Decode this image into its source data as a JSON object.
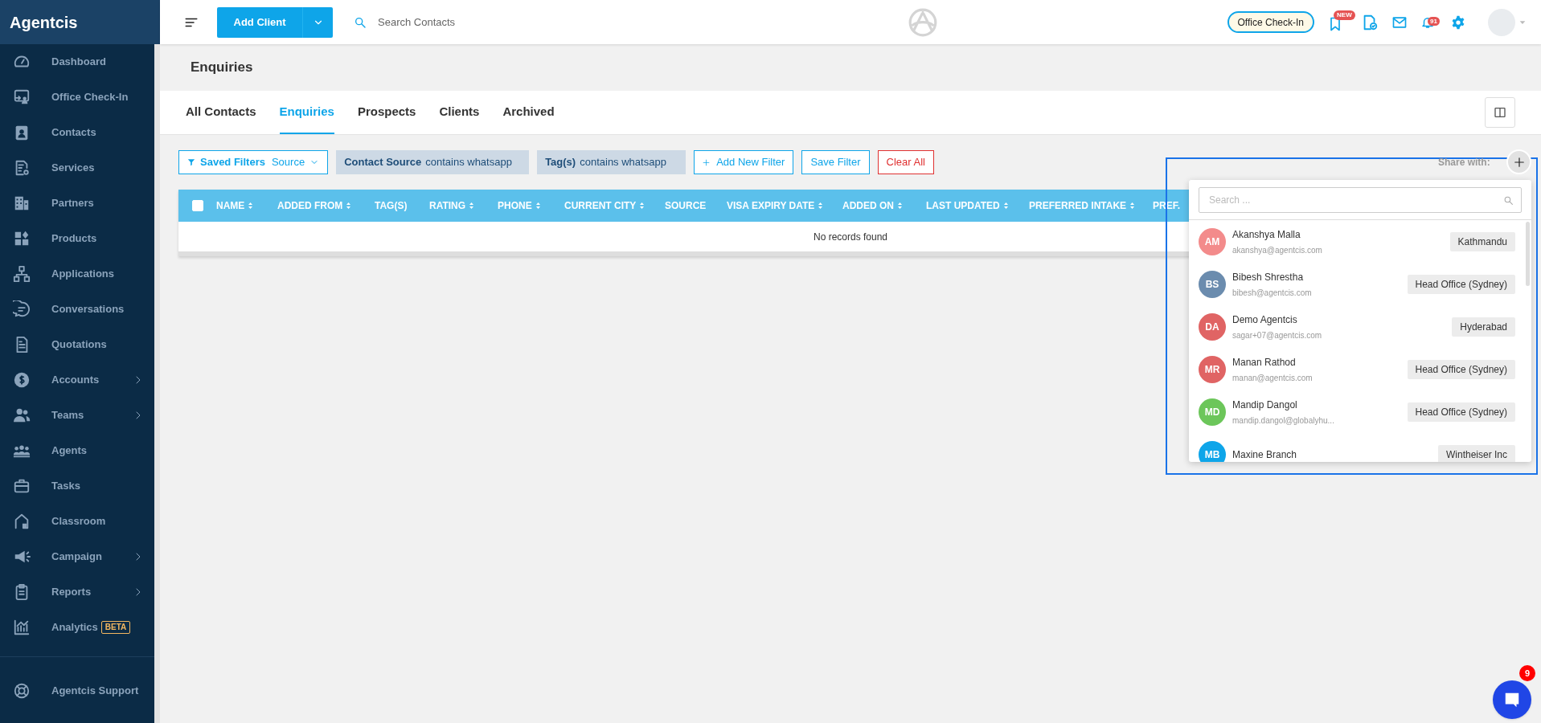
{
  "sidebar": {
    "brand": "Agentcis",
    "items": [
      {
        "label": "Dashboard",
        "expandable": false
      },
      {
        "label": "Office Check-In",
        "expandable": false
      },
      {
        "label": "Contacts",
        "expandable": false
      },
      {
        "label": "Services",
        "expandable": false
      },
      {
        "label": "Partners",
        "expandable": false
      },
      {
        "label": "Products",
        "expandable": false
      },
      {
        "label": "Applications",
        "expandable": false
      },
      {
        "label": "Conversations",
        "expandable": false
      },
      {
        "label": "Quotations",
        "expandable": false
      },
      {
        "label": "Accounts",
        "expandable": true
      },
      {
        "label": "Teams",
        "expandable": true
      },
      {
        "label": "Agents",
        "expandable": false
      },
      {
        "label": "Tasks",
        "expandable": false
      },
      {
        "label": "Classroom",
        "expandable": false
      },
      {
        "label": "Campaign",
        "expandable": true
      },
      {
        "label": "Reports",
        "expandable": true
      },
      {
        "label": "Analytics",
        "expandable": false,
        "badge": "BETA"
      }
    ],
    "footer_items": [
      {
        "label": "Agentcis Support"
      }
    ]
  },
  "top_bar": {
    "add_button": "Add Client",
    "search": {
      "placeholder": "Search Contacts"
    },
    "check_in_button": "Office Check-In",
    "updates_badge": "NEW",
    "notifications_badge": "91"
  },
  "page": {
    "title": "Enquiries"
  },
  "tabs": [
    {
      "label": "All Contacts",
      "selected": false
    },
    {
      "label": "Enquiries",
      "selected": true
    },
    {
      "label": "Prospects",
      "selected": false
    },
    {
      "label": "Clients",
      "selected": false
    },
    {
      "label": "Archived",
      "selected": false
    }
  ],
  "filters": {
    "saved_filters": {
      "label": "Saved Filters",
      "value": "Source"
    },
    "conditions": [
      {
        "field": "Contact Source",
        "condition": "contains whatsapp"
      },
      {
        "field": "Tag(s)",
        "condition": "contains whatsapp"
      }
    ],
    "add_button": "Add New Filter",
    "save_button": "Save Filter",
    "clear_button": "Clear All"
  },
  "table": {
    "select_all": {
      "checked": false
    },
    "columns": [
      {
        "label": "NAME",
        "sortable": true
      },
      {
        "label": "ADDED FROM",
        "sortable": true
      },
      {
        "label": "TAG(S)",
        "sortable": false
      },
      {
        "label": "RATING",
        "sortable": true
      },
      {
        "label": "PHONE",
        "sortable": true
      },
      {
        "label": "CURRENT CITY",
        "sortable": true
      },
      {
        "label": "SOURCE",
        "sortable": false
      },
      {
        "label": "VISA EXPIRY DATE",
        "sortable": true
      },
      {
        "label": "ADDED ON",
        "sortable": true
      },
      {
        "label": "LAST UPDATED",
        "sortable": true
      },
      {
        "label": "PREFERRED INTAKE",
        "sortable": true
      },
      {
        "label": "PREF.",
        "sortable": false
      }
    ],
    "empty_message": "No records found"
  },
  "share_panel": {
    "label": "Share with:",
    "search": {
      "placeholder": "Search ..."
    },
    "users": [
      {
        "initials": "AM",
        "name": "Akanshya Malla",
        "email": "akanshya@agentcis.com",
        "office": "Kathmandu",
        "color": "#f38b8b"
      },
      {
        "initials": "BS",
        "name": "Bibesh Shrestha",
        "email": "bibesh@agentcis.com",
        "office": "Head Office (Sydney)",
        "color": "#6b8cae"
      },
      {
        "initials": "DA",
        "name": "Demo Agentcis",
        "email": "sagar+07@agentcis.com",
        "office": "Hyderabad",
        "color": "#e06464"
      },
      {
        "initials": "MR",
        "name": "Manan Rathod",
        "email": "manan@agentcis.com",
        "office": "Head Office (Sydney)",
        "color": "#e06464"
      },
      {
        "initials": "MD",
        "name": "Mandip Dangol",
        "email": "mandip.dangol@globalyhu...",
        "office": "Head Office (Sydney)",
        "color": "#6cc65a"
      },
      {
        "initials": "MB",
        "name": "Maxine Branch",
        "office": "Wintheiser Inc",
        "color": "#0ea5e9"
      }
    ]
  },
  "chat_widget": {
    "badge": "9"
  }
}
